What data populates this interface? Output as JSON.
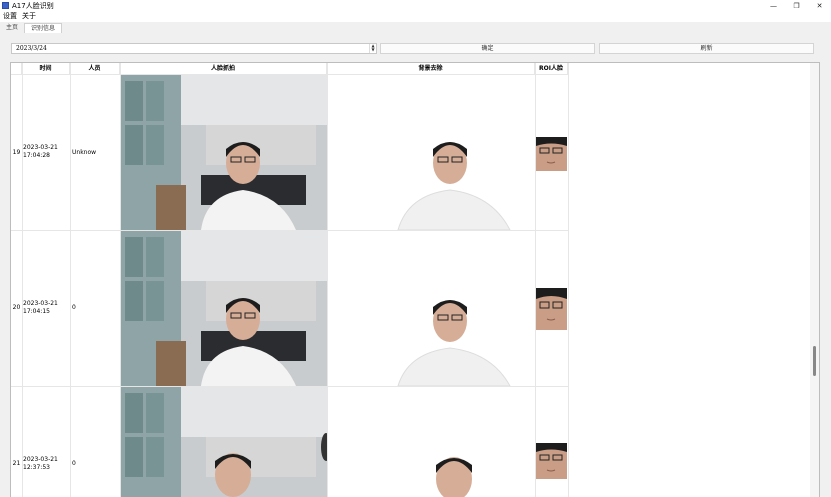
{
  "window": {
    "title": "A17人脸识别",
    "minimize": "—",
    "restore": "❐",
    "close": "✕"
  },
  "menu": {
    "items": [
      "设置",
      "关于"
    ]
  },
  "tabs": [
    {
      "label": "主页",
      "active": false
    },
    {
      "label": "识别信息",
      "active": true
    }
  ],
  "toolbar": {
    "date_value": "2023/3/24",
    "ok_label": "确定",
    "refresh_label": "刷新"
  },
  "table": {
    "headers": {
      "time": "时间",
      "person": "人员",
      "capture": "人脸抓拍",
      "bg_removed": "背景去除",
      "roi": "ROI人脸"
    },
    "rows": [
      {
        "num": "19",
        "date": "2023-03-21",
        "time": "17:04:28",
        "person": "Unknow"
      },
      {
        "num": "20",
        "date": "2023-03-21",
        "time": "17:04:15",
        "person": "0"
      },
      {
        "num": "21",
        "date": "2023-03-21",
        "time": "12:37:53",
        "person": "0"
      }
    ]
  },
  "colors": {
    "accent": "#3a64c8",
    "panel_bg": "#f0f0f0",
    "grid": "#e6e6e6"
  }
}
